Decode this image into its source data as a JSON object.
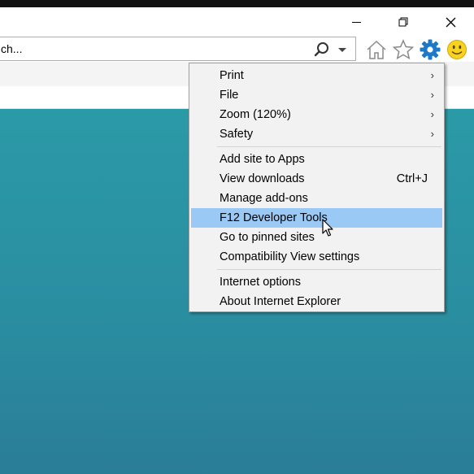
{
  "window": {
    "controls": [
      "minimize",
      "restore",
      "close"
    ]
  },
  "addressbar": {
    "text": "ch...",
    "search_icon": "search-icon",
    "dropdown_icon": "chevron-down-icon"
  },
  "toolbar": {
    "icons": [
      "home-icon",
      "star-icon",
      "gear-icon",
      "smiley-icon"
    ]
  },
  "colors": {
    "accent": "#1e78c8",
    "highlight": "#99c9f4",
    "content_top": "#2b9aa7",
    "content_bottom": "#2a7d97",
    "smiley": "#f7d21e"
  },
  "menu": {
    "groups": [
      [
        {
          "label": "Print",
          "submenu": true
        },
        {
          "label": "File",
          "submenu": true
        },
        {
          "label": "Zoom (120%)",
          "submenu": true
        },
        {
          "label": "Safety",
          "submenu": true
        }
      ],
      [
        {
          "label": "Add site to Apps"
        },
        {
          "label": "View downloads",
          "shortcut": "Ctrl+J"
        },
        {
          "label": "Manage add-ons"
        },
        {
          "label": "F12 Developer Tools",
          "highlighted": true
        },
        {
          "label": "Go to pinned sites"
        },
        {
          "label": "Compatibility View settings"
        }
      ],
      [
        {
          "label": "Internet options"
        },
        {
          "label": "About Internet Explorer"
        }
      ]
    ],
    "print": "Print",
    "file": "File",
    "zoom": "Zoom (120%)",
    "safety": "Safety",
    "add_site": "Add site to Apps",
    "view_downloads": "View downloads",
    "view_downloads_shortcut": "Ctrl+J",
    "manage_addons": "Manage add-ons",
    "f12": "F12 Developer Tools",
    "pinned_sites": "Go to pinned sites",
    "compat_view": "Compatibility View settings",
    "internet_options": "Internet options",
    "about_ie": "About Internet Explorer",
    "submenu_arrow": "›"
  }
}
